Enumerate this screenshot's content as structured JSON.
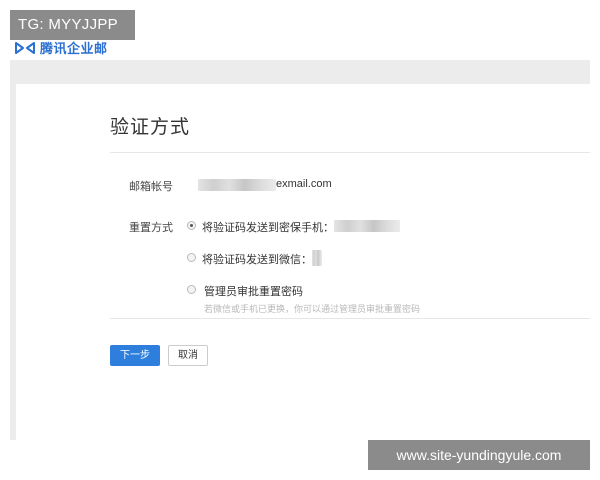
{
  "watermarks": {
    "top_left": "TG: MYYJJPP",
    "bottom_right": "www.site-yundingyule.com"
  },
  "header": {
    "logo_text": "腾讯企业邮",
    "logo_icon": "tencent-exmail-logo-icon",
    "brand_color": "#2a6fd1"
  },
  "main": {
    "title": "验证方式",
    "email_label": "邮箱帐号",
    "email_suffix": "exmail.com",
    "reset_label": "重置方式",
    "options": [
      {
        "label": "将验证码发送到密保手机：",
        "selected": true
      },
      {
        "label": "将验证码发送到微信：",
        "selected": false
      },
      {
        "label": "管理员审批重置密码",
        "selected": false,
        "hint": "若微信或手机已更换，你可以通过管理员审批重置密码"
      }
    ],
    "buttons": {
      "next": "下一步",
      "cancel": "取消"
    },
    "accent_color": "#2e7fdd"
  }
}
